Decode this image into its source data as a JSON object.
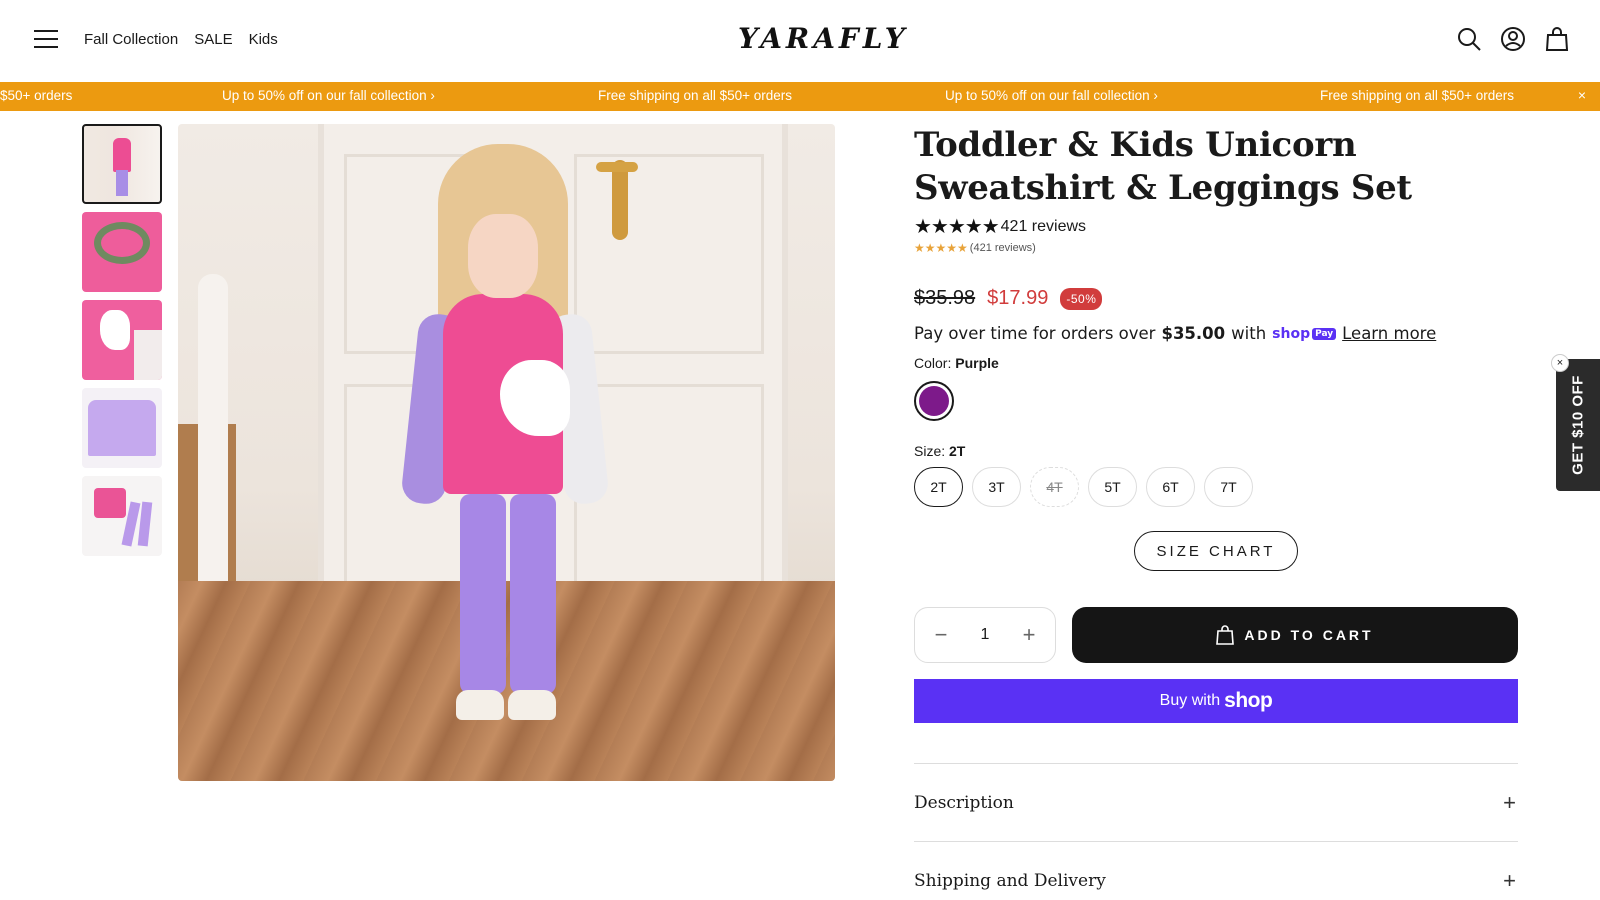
{
  "header": {
    "nav": [
      "Fall Collection",
      "SALE",
      "Kids"
    ],
    "logo": "YARAFLY"
  },
  "announcement": {
    "items": [
      "$50+ orders",
      "Up to 50% off on our fall collection ›",
      "Free shipping on all $50+ orders",
      "Up to 50% off on our fall collection ›",
      "Free shipping on all $50+ orders"
    ],
    "close": "×"
  },
  "product": {
    "title": "Toddler & Kids Unicorn Sweatshirt & Leggings Set",
    "reviews": "421 reviews",
    "reviews_small": "(421 reviews)",
    "rating": 5,
    "old_price": "$35.98",
    "new_price": "$17.99",
    "discount": "-50%",
    "pay_over_prefix": "Pay over time for orders over",
    "pay_over_amount": "$35.00",
    "pay_over_with": "with",
    "shop_pay_label": "shop",
    "shop_pay_badge": "Pay",
    "learn_more": "Learn more",
    "color_label": "Color:",
    "color_value": "Purple",
    "color_swatch": "#7d1a8a",
    "size_label": "Size:",
    "size_value": "2T",
    "sizes": [
      "2T",
      "3T",
      "4T",
      "5T",
      "6T",
      "7T"
    ],
    "size_chart": "SIZE CHART",
    "quantity": "1",
    "add_to_cart": "ADD TO CART",
    "buy_with": "Buy with",
    "buy_shop": "shop",
    "accordion": [
      "Description",
      "Shipping and Delivery"
    ]
  },
  "side_tab": {
    "label": "GET $10 OFF",
    "close": "×"
  },
  "colors": {
    "announcement_bg": "#ec9a10",
    "sale_red": "#d13c3c",
    "shop_purple": "#5a31f4"
  }
}
